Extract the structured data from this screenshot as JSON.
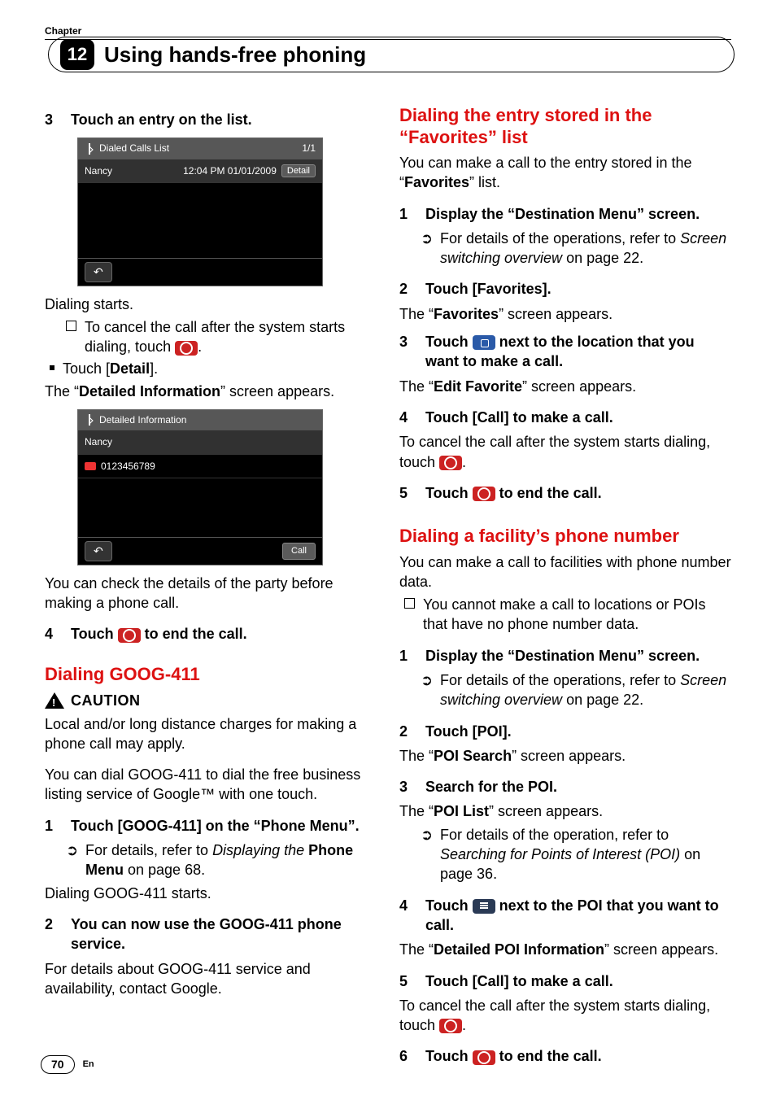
{
  "chapter": {
    "label": "Chapter",
    "number": "12",
    "title": "Using hands-free phoning"
  },
  "left": {
    "step3": "Touch an entry on the list.",
    "ss1": {
      "title": "Dialed Calls List",
      "page": "1/1",
      "name": "Nancy",
      "time": "12:04 PM 01/01/2009",
      "detail": "Detail"
    },
    "dialing_starts": "Dialing starts.",
    "cancel1a": "To cancel the call after the system starts",
    "cancel1b": "dialing, touch ",
    "period1": ".",
    "touch_detail_a": "Touch [",
    "touch_detail_b": "Detail",
    "touch_detail_c": "].",
    "di_a": "The “",
    "di_b": "Detailed Information",
    "di_c": "” screen appears.",
    "ss2": {
      "title": "Detailed Information",
      "name": "Nancy",
      "number": "0123456789",
      "call": "Call"
    },
    "check_details": "You can check the details of the party before making a phone call.",
    "step4_a": "Touch ",
    "step4_b": " to end the call.",
    "goog_h": "Dialing GOOG-411",
    "caution": "CAUTION",
    "goog_warn": "Local and/or long distance charges for making a phone call may apply.",
    "goog_intro": "You can dial GOOG-411 to dial the free business listing service of Google™ with one touch.",
    "g1": "Touch [GOOG-411] on the “Phone Menu”.",
    "g1_ref_a": "For details, refer to ",
    "g1_ref_b": "Displaying the",
    "g1_ref_c": " Phone Menu",
    "g1_ref_d": " on page 68.",
    "g1_dial": "Dialing GOOG-411 starts.",
    "g2": "You can now use the GOOG-411 phone service.",
    "g2_body": "For details about GOOG-411 service and availability, contact Google."
  },
  "right": {
    "fav_h": "Dialing the entry stored in the “Favorites” list",
    "fav_intro_a": "You can make a call to the entry stored in the “",
    "fav_intro_b": "Favorites",
    "fav_intro_c": "” list.",
    "f1": "Display the “Destination Menu” screen.",
    "f1_ref_a": "For details of the operations, refer to ",
    "f1_ref_b": "Screen switching overview",
    "f1_ref_c": " on page 22.",
    "f2": "Touch [Favorites].",
    "f2_body_a": "The “",
    "f2_body_b": "Favorites",
    "f2_body_c": "” screen appears.",
    "f3_a": "Touch ",
    "f3_b": " next to the location that you want to make a call.",
    "f3_body_a": "The “",
    "f3_body_b": "Edit Favorite",
    "f3_body_c": "” screen appears.",
    "f4": "Touch [Call] to make a call.",
    "f4_body_a": "To cancel the call after the system starts dialing, touch ",
    "f4_body_b": ".",
    "f5_a": "Touch ",
    "f5_b": " to end the call.",
    "fac_h": "Dialing a facility’s phone number",
    "fac_intro": "You can make a call to facilities with phone number data.",
    "fac_note": "You cannot make a call to locations or POIs that have no phone number data.",
    "p1": "Display the “Destination Menu” screen.",
    "p1_ref_a": "For details of the operations, refer to ",
    "p1_ref_b": "Screen switching overview",
    "p1_ref_c": " on page 22.",
    "p2": "Touch [POI].",
    "p2_body_a": "The “",
    "p2_body_b": "POI Search",
    "p2_body_c": "” screen appears.",
    "p3": "Search for the POI.",
    "p3_body_a": "The “",
    "p3_body_b": "POI List",
    "p3_body_c": "” screen appears.",
    "p3_ref_a": "For details of the operation, refer to ",
    "p3_ref_b": "Searching for Points of Interest (POI)",
    "p3_ref_c": " on page 36.",
    "p4_a": "Touch ",
    "p4_b": " next to the POI that you want to call.",
    "p4_body_a": "The “",
    "p4_body_b": "Detailed POI Information",
    "p4_body_c": "” screen appears.",
    "p5": "Touch [Call] to make a call.",
    "p5_body_a": "To cancel the call after the system starts dialing, touch ",
    "p5_body_b": ".",
    "p6_a": "Touch ",
    "p6_b": " to end the call."
  },
  "page": {
    "num": "70",
    "lang": "En"
  }
}
